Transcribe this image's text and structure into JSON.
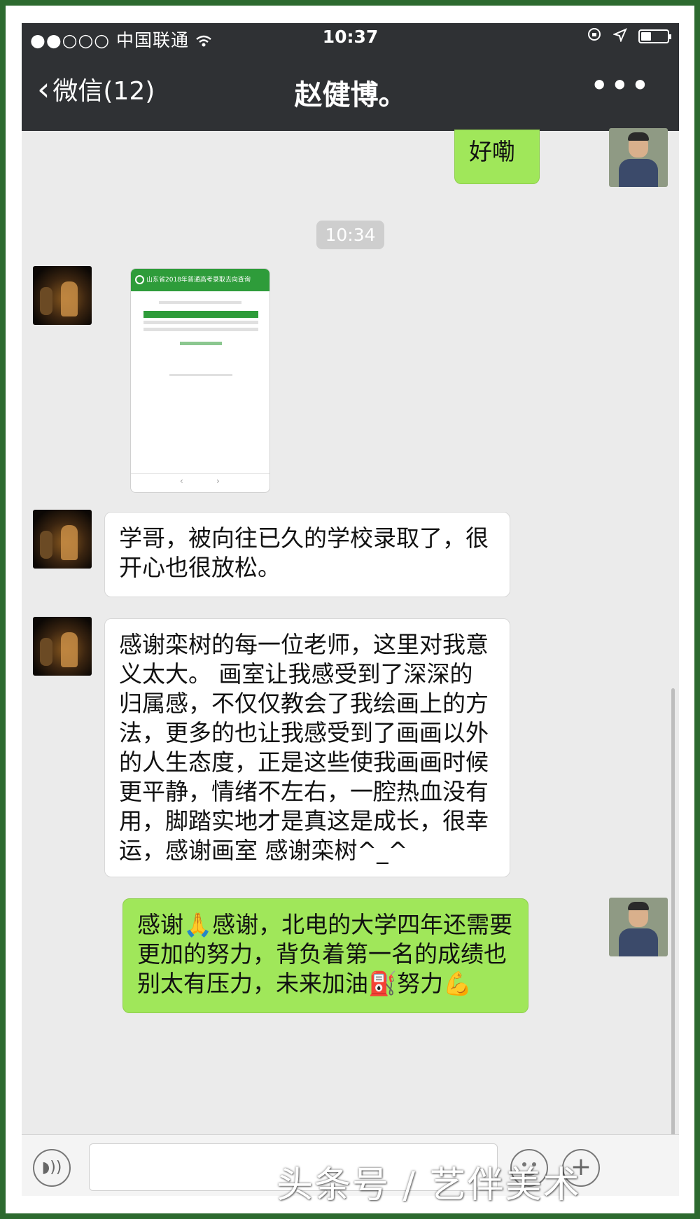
{
  "status_bar": {
    "signal": "●●○○○",
    "carrier": "中国联通",
    "wifi_icon": "wifi-icon",
    "time": "10:37"
  },
  "nav_bar": {
    "back_label": "微信(12)",
    "title": "赵健博。",
    "more_icon": "more-icon"
  },
  "messages": [
    {
      "sender": "me",
      "type": "text",
      "text": "好嘞"
    },
    {
      "type": "timestamp",
      "text": "10:34"
    },
    {
      "sender": "friend",
      "type": "image",
      "caption": "山东省2018年普通高考录取去向查询"
    },
    {
      "sender": "friend",
      "type": "text",
      "text": "学哥，被向往已久的学校录取了，很开心也很放松。"
    },
    {
      "sender": "friend",
      "type": "text",
      "text": "感谢栾树的每一位老师，这里对我意义太大。 画室让我感受到了深深的归属感，不仅仅教会了我绘画上的方法，更多的也让我感受到了画画以外的人生态度，正是这些使我画画时候更平静，情绪不左右，一腔热血没有用，脚踏实地才是真这是成长，很幸运，感谢画室 感谢栾树^_^"
    },
    {
      "sender": "me",
      "type": "text",
      "text": "感谢🙏感谢，北电的大学四年还需要更加的努力，背负着第一名的成绩也别太有压力，未来加油⛽努力💪"
    }
  ],
  "watermark": "头条号 / 艺伴美术",
  "colors": {
    "nav_bg": "#2f3134",
    "chat_bg": "#ebebeb",
    "my_bubble": "#a0e75a",
    "friend_bubble": "#ffffff",
    "border": "#2d6a2f"
  }
}
